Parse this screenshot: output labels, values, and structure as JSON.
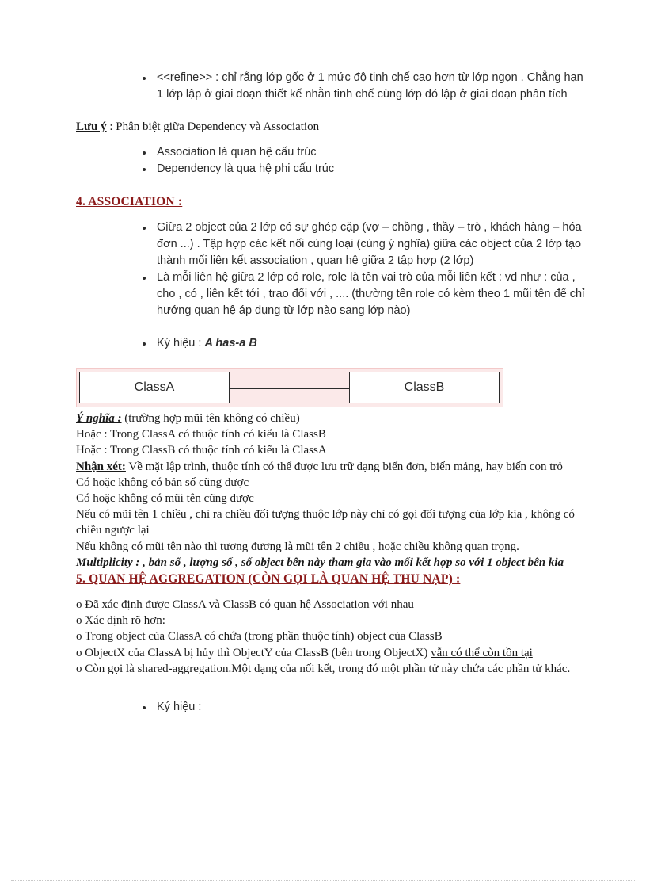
{
  "document": {
    "title": "UML Association and Aggregation notes"
  },
  "refine_section": {
    "bullets": [
      "<<refine>> : chỉ rằng lớp gốc ở 1 mức độ tinh chế cao hơn từ lớp ngọn . Chẳng hạn 1 lớp lập ở giai đoạn thiết kế nhằn tinh chế cùng lớp đó lập ở giai đoạn phân tích"
    ]
  },
  "note": {
    "label": "Lưu ý",
    "separator": " : ",
    "text": "Phân biệt giữa Dependency và Association",
    "bullets": [
      "Association là quan hệ cấu trúc",
      "Dependency là qua hệ phi cấu trúc"
    ]
  },
  "association_section": {
    "heading": "4. ASSOCIATION  :",
    "heading_color": "#8b1a1a",
    "bullets": [
      "Giữa 2 object của 2 lớp có sự ghép cặp (vợ – chồng , thầy – trò , khách hàng – hóa đơn ...) . Tập hợp các kết nối cùng loại (cùng ý nghĩa) giữa các object của 2 lớp tạo thành mối liên kết association , quan hệ giữa 2 tập hợp (2 lớp)",
      "Là mỗi liên hệ giữa 2 lớp có role, role là tên vai trò của mỗi liên kết : vd như : của , cho , có , liên kết tới , trao đổi với , .... (thường tên role có kèm theo 1 mũi tên để chỉ hướng quan hệ áp dụng từ lớp nào sang lớp nào)"
    ],
    "notation_label": "Ký hiệu : ",
    "notation_value": "A has-a B"
  },
  "diagram": {
    "class_a": "ClassA",
    "class_b": "ClassB",
    "band_color": "#fbe9e9",
    "band_border": "#f3c9c9",
    "box_border": "#2b2b2b"
  },
  "meaning_block": {
    "label": "Ý nghĩa :",
    "label_rest": " (trường hợp mũi tên không có chiều)",
    "lines": [
      "Hoặc : Trong ClassA có thuộc tính có kiểu là ClassB",
      "Hoặc : Trong ClassB có thuộc tính có kiểu là ClassA"
    ],
    "remark_label": "Nhận xét:",
    "remark_text": " Về mặt lập trình, thuộc tính có thể được lưu trữ dạng biến đơn, biến mảng, hay biến con trỏ",
    "more_lines": [
      "Có hoặc không có bản số cũng được",
      "Có hoặc không có mũi tên cũng được",
      "Nếu có mũi tên 1 chiều , chỉ ra chiều đối tượng thuộc lớp này chỉ có gọi đối tượng của lớp kia , không có chiều ngược lại",
      "Nếu không có mũi tên nào thì tương đương là mũi tên 2 chiều , hoặc chiều không quan trọng."
    ],
    "multiplicity_label": "Multiplicity",
    "multiplicity_text": " : , bản số , lượng số , số object bên này tham gia vào mối kết hợp so với 1 object bên kia"
  },
  "aggregation_section": {
    "heading": "5. QUAN HỆ AGGREGATION  (CÒN GỌI LÀ QUAN HỆ THU NẠP) :",
    "heading_color": "#8b1a1a",
    "items": [
      "o Đã xác định được ClassA và ClassB có quan hệ Association  với nhau",
      "o Xác định rõ hơn:",
      "o Trong object của ClassA có chứa (trong phần thuộc tính)  object của ClassB"
    ],
    "item_objectx_prefix": "o ObjectX của ClassA bị hủy thì ObjectY của ClassB (bên trong ObjectX) ",
    "item_objectx_underlined": "vẫn có thể còn tồn tại",
    "item_shared": "o Còn gọi là shared-aggregation.Một  dạng của nối kết, trong đó một phần tử này chứa các phần tử khác.",
    "notation_label": "Ký hiệu :"
  }
}
